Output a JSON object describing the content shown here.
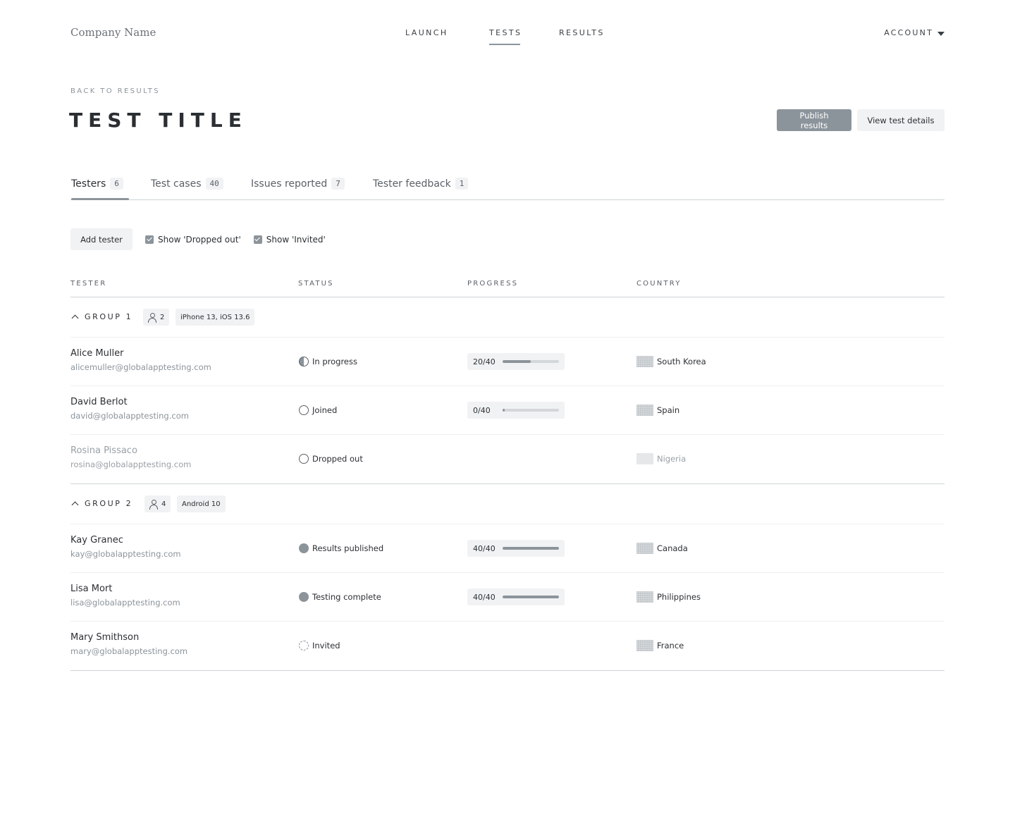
{
  "header": {
    "company": "Company Name",
    "nav": [
      {
        "label": "LAUNCH",
        "active": false
      },
      {
        "label": "TESTS",
        "active": true
      },
      {
        "label": "RESULTS",
        "active": false
      }
    ],
    "account": "ACCOUNT"
  },
  "page": {
    "back_link": "BACK TO RESULTS",
    "title": "TEST TITLE",
    "publish_button": "Publish results",
    "details_button": "View test details"
  },
  "tabs": [
    {
      "label": "Testers",
      "count": "6",
      "active": true
    },
    {
      "label": "Test cases",
      "count": "40",
      "active": false
    },
    {
      "label": "Issues reported",
      "count": "7",
      "active": false
    },
    {
      "label": "Tester feedback",
      "count": "1",
      "active": false
    }
  ],
  "toolbar": {
    "add_button": "Add tester",
    "filters": [
      {
        "label": "Show 'Dropped out'",
        "checked": true
      },
      {
        "label": "Show 'Invited'",
        "checked": true
      }
    ]
  },
  "table": {
    "columns": [
      "TESTER",
      "STATUS",
      "PROGRESS",
      "COUNTRY"
    ],
    "groups": [
      {
        "name": "GROUP 1",
        "member_count": "2",
        "device": "iPhone 13, iOS 13.6",
        "rows": [
          {
            "name": "Alice Muller",
            "email": "alicemuller@globalapptesting.com",
            "status": "In progress",
            "status_icon": "half-circle-icon",
            "progress_label": "20/40",
            "progress": 0.5,
            "country": "South Korea",
            "muted": false
          },
          {
            "name": "David Berlot",
            "email": "david@globalapptesting.com",
            "status": "Joined",
            "status_icon": "empty-circle-icon",
            "progress_label": "0/40",
            "progress": 0.0,
            "country": "Spain",
            "muted": false
          },
          {
            "name": "Rosina Pissaco",
            "email": "rosina@globalapptesting.com",
            "status": "Dropped out",
            "status_icon": "empty-circle-icon",
            "progress_label": null,
            "progress": null,
            "country": "Nigeria",
            "muted": true
          }
        ]
      },
      {
        "name": "GROUP 2",
        "member_count": "4",
        "device": "Android 10",
        "rows": [
          {
            "name": "Kay Granec",
            "email": "kay@globalapptesting.com",
            "status": "Results published",
            "status_icon": "filled-circle-icon",
            "progress_label": "40/40",
            "progress": 1.0,
            "country": "Canada",
            "muted": false
          },
          {
            "name": "Lisa Mort",
            "email": "lisa@globalapptesting.com",
            "status": "Testing complete",
            "status_icon": "filled-circle-icon",
            "progress_label": "40/40",
            "progress": 1.0,
            "country": "Philippines",
            "muted": false
          },
          {
            "name": "Mary Smithson",
            "email": "mary@globalapptesting.com",
            "status": "Invited",
            "status_icon": "dashed-circle-icon",
            "progress_label": null,
            "progress": null,
            "country": "France",
            "muted": false
          }
        ]
      }
    ]
  }
}
